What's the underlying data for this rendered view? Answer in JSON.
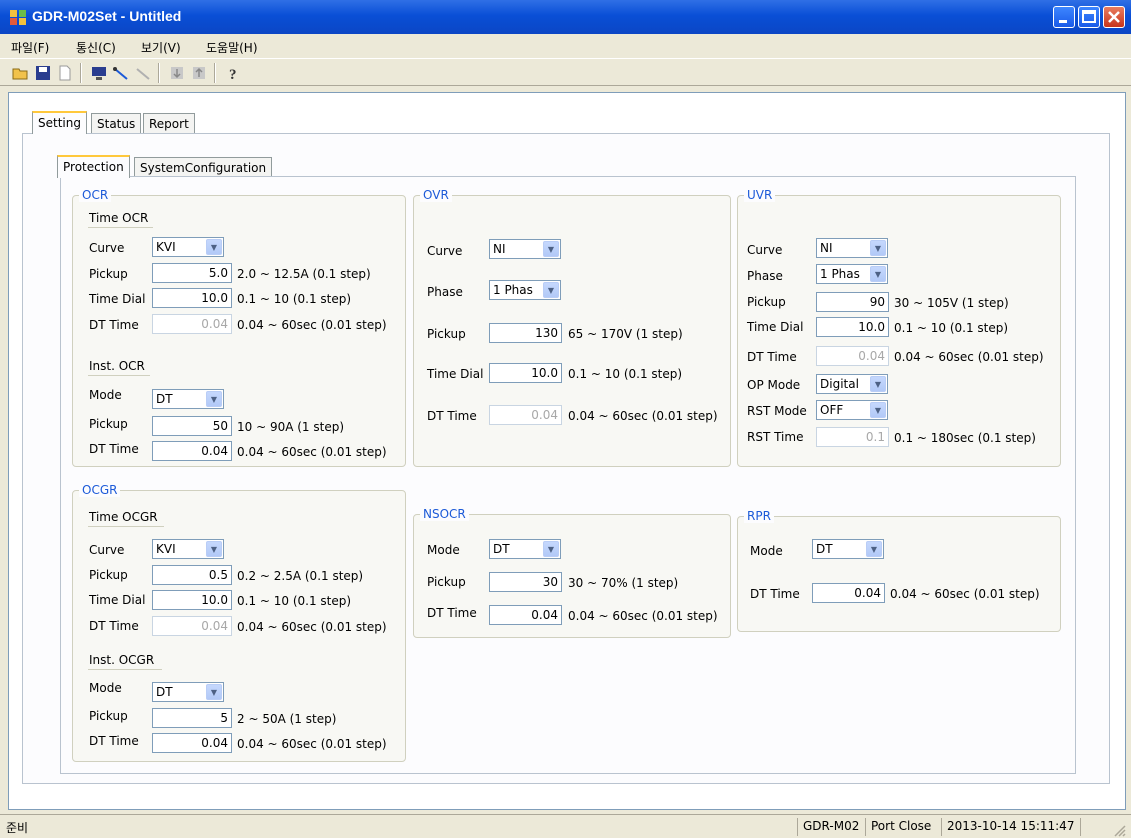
{
  "window": {
    "title": "GDR-M02Set - Untitled"
  },
  "menu": [
    "파일(F)",
    "통신(C)",
    "보기(V)",
    "도움말(H)"
  ],
  "tabs_outer": [
    "Setting",
    "Status",
    "Report"
  ],
  "tabs_inner": [
    "Protection",
    "SystemConfiguration"
  ],
  "ocr": {
    "title": "OCR",
    "time_title": "Time OCR",
    "curve_label": "Curve",
    "curve_value": "KVI",
    "pickup_label": "Pickup",
    "pickup_value": "5.0",
    "pickup_range": "2.0 ~ 12.5A (0.1 step)",
    "dial_label": "Time Dial",
    "dial_value": "10.0",
    "dial_range": "0.1 ~ 10 (0.1 step)",
    "dt_label": "DT Time",
    "dt_value": "0.04",
    "dt_range": "0.04 ~ 60sec (0.01 step)",
    "inst_title": "Inst. OCR",
    "mode_label": "Mode",
    "mode_value": "DT",
    "inst_pickup_label": "Pickup",
    "inst_pickup_value": "50",
    "inst_pickup_range": "10 ~ 90A (1 step)",
    "inst_dt_label": "DT Time",
    "inst_dt_value": "0.04",
    "inst_dt_range": "0.04 ~ 60sec (0.01 step)"
  },
  "ocgr": {
    "title": "OCGR",
    "time_title": "Time OCGR",
    "curve_label": "Curve",
    "curve_value": "KVI",
    "pickup_label": "Pickup",
    "pickup_value": "0.5",
    "pickup_range": "0.2 ~ 2.5A (0.1 step)",
    "dial_label": "Time Dial",
    "dial_value": "10.0",
    "dial_range": "0.1 ~ 10 (0.1 step)",
    "dt_label": "DT Time",
    "dt_value": "0.04",
    "dt_range": "0.04 ~ 60sec (0.01 step)",
    "inst_title": "Inst. OCGR",
    "mode_label": "Mode",
    "mode_value": "DT",
    "inst_pickup_label": "Pickup",
    "inst_pickup_value": "5",
    "inst_pickup_range": "2 ~ 50A (1 step)",
    "inst_dt_label": "DT Time",
    "inst_dt_value": "0.04",
    "inst_dt_range": "0.04 ~ 60sec (0.01 step)"
  },
  "ovr": {
    "title": "OVR",
    "curve_label": "Curve",
    "curve_value": "NI",
    "phase_label": "Phase",
    "phase_value": "1 Phas",
    "pickup_label": "Pickup",
    "pickup_value": "130",
    "pickup_range": "65 ~ 170V (1 step)",
    "dial_label": "Time Dial",
    "dial_value": "10.0",
    "dial_range": "0.1 ~ 10 (0.1 step)",
    "dt_label": "DT Time",
    "dt_value": "0.04",
    "dt_range": "0.04 ~ 60sec (0.01 step)"
  },
  "nsocr": {
    "title": "NSOCR",
    "mode_label": "Mode",
    "mode_value": "DT",
    "pickup_label": "Pickup",
    "pickup_value": "30",
    "pickup_range": "30 ~ 70% (1 step)",
    "dt_label": "DT Time",
    "dt_value": "0.04",
    "dt_range": "0.04 ~ 60sec (0.01 step)"
  },
  "uvr": {
    "title": "UVR",
    "curve_label": "Curve",
    "curve_value": "NI",
    "phase_label": "Phase",
    "phase_value": "1 Phas",
    "pickup_label": "Pickup",
    "pickup_value": "90",
    "pickup_range": "30 ~ 105V (1 step)",
    "dial_label": "Time Dial",
    "dial_value": "10.0",
    "dial_range": "0.1 ~ 10 (0.1 step)",
    "dt_label": "DT Time",
    "dt_value": "0.04",
    "dt_range": "0.04 ~ 60sec (0.01 step)",
    "op_label": "OP Mode",
    "op_value": "Digital",
    "rst_mode_label": "RST Mode",
    "rst_mode_value": "OFF",
    "rst_time_label": "RST Time",
    "rst_time_value": "0.1",
    "rst_time_range": "0.1 ~ 180sec (0.1 step)"
  },
  "rpr": {
    "title": "RPR",
    "mode_label": "Mode",
    "mode_value": "DT",
    "dt_label": "DT Time",
    "dt_value": "0.04",
    "dt_range": "0.04 ~ 60sec (0.01 step)"
  },
  "status": {
    "left": "준비",
    "device": "GDR-M02",
    "port": "Port Close",
    "datetime": "2013-10-14 15:11:47"
  },
  "colors": {
    "title_bar": "#0a4fd6",
    "group_title": "#1c5ad8",
    "active_tab_accent": "#ffc83c"
  }
}
